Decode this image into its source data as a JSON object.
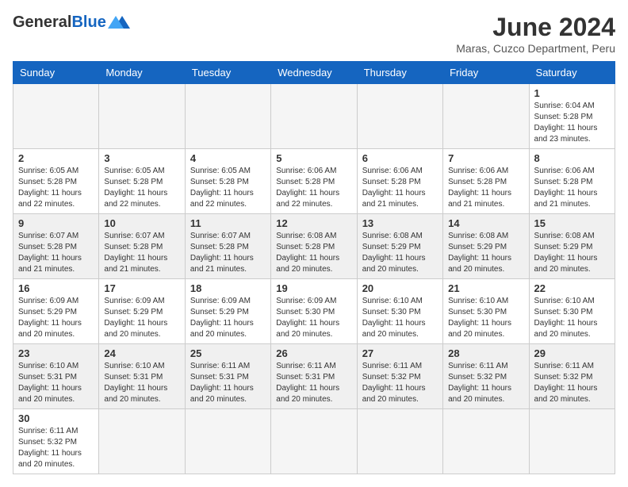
{
  "header": {
    "logo_general": "General",
    "logo_blue": "Blue",
    "month_title": "June 2024",
    "subtitle": "Maras, Cuzco Department, Peru"
  },
  "weekdays": [
    "Sunday",
    "Monday",
    "Tuesday",
    "Wednesday",
    "Thursday",
    "Friday",
    "Saturday"
  ],
  "weeks": [
    {
      "shaded": false,
      "days": [
        {
          "num": "",
          "info": ""
        },
        {
          "num": "",
          "info": ""
        },
        {
          "num": "",
          "info": ""
        },
        {
          "num": "",
          "info": ""
        },
        {
          "num": "",
          "info": ""
        },
        {
          "num": "",
          "info": ""
        },
        {
          "num": "1",
          "info": "Sunrise: 6:04 AM\nSunset: 5:28 PM\nDaylight: 11 hours\nand 23 minutes."
        }
      ]
    },
    {
      "shaded": false,
      "days": [
        {
          "num": "2",
          "info": "Sunrise: 6:05 AM\nSunset: 5:28 PM\nDaylight: 11 hours\nand 22 minutes."
        },
        {
          "num": "3",
          "info": "Sunrise: 6:05 AM\nSunset: 5:28 PM\nDaylight: 11 hours\nand 22 minutes."
        },
        {
          "num": "4",
          "info": "Sunrise: 6:05 AM\nSunset: 5:28 PM\nDaylight: 11 hours\nand 22 minutes."
        },
        {
          "num": "5",
          "info": "Sunrise: 6:06 AM\nSunset: 5:28 PM\nDaylight: 11 hours\nand 22 minutes."
        },
        {
          "num": "6",
          "info": "Sunrise: 6:06 AM\nSunset: 5:28 PM\nDaylight: 11 hours\nand 21 minutes."
        },
        {
          "num": "7",
          "info": "Sunrise: 6:06 AM\nSunset: 5:28 PM\nDaylight: 11 hours\nand 21 minutes."
        },
        {
          "num": "8",
          "info": "Sunrise: 6:06 AM\nSunset: 5:28 PM\nDaylight: 11 hours\nand 21 minutes."
        }
      ]
    },
    {
      "shaded": true,
      "days": [
        {
          "num": "9",
          "info": "Sunrise: 6:07 AM\nSunset: 5:28 PM\nDaylight: 11 hours\nand 21 minutes."
        },
        {
          "num": "10",
          "info": "Sunrise: 6:07 AM\nSunset: 5:28 PM\nDaylight: 11 hours\nand 21 minutes."
        },
        {
          "num": "11",
          "info": "Sunrise: 6:07 AM\nSunset: 5:28 PM\nDaylight: 11 hours\nand 21 minutes."
        },
        {
          "num": "12",
          "info": "Sunrise: 6:08 AM\nSunset: 5:28 PM\nDaylight: 11 hours\nand 20 minutes."
        },
        {
          "num": "13",
          "info": "Sunrise: 6:08 AM\nSunset: 5:29 PM\nDaylight: 11 hours\nand 20 minutes."
        },
        {
          "num": "14",
          "info": "Sunrise: 6:08 AM\nSunset: 5:29 PM\nDaylight: 11 hours\nand 20 minutes."
        },
        {
          "num": "15",
          "info": "Sunrise: 6:08 AM\nSunset: 5:29 PM\nDaylight: 11 hours\nand 20 minutes."
        }
      ]
    },
    {
      "shaded": false,
      "days": [
        {
          "num": "16",
          "info": "Sunrise: 6:09 AM\nSunset: 5:29 PM\nDaylight: 11 hours\nand 20 minutes."
        },
        {
          "num": "17",
          "info": "Sunrise: 6:09 AM\nSunset: 5:29 PM\nDaylight: 11 hours\nand 20 minutes."
        },
        {
          "num": "18",
          "info": "Sunrise: 6:09 AM\nSunset: 5:29 PM\nDaylight: 11 hours\nand 20 minutes."
        },
        {
          "num": "19",
          "info": "Sunrise: 6:09 AM\nSunset: 5:30 PM\nDaylight: 11 hours\nand 20 minutes."
        },
        {
          "num": "20",
          "info": "Sunrise: 6:10 AM\nSunset: 5:30 PM\nDaylight: 11 hours\nand 20 minutes."
        },
        {
          "num": "21",
          "info": "Sunrise: 6:10 AM\nSunset: 5:30 PM\nDaylight: 11 hours\nand 20 minutes."
        },
        {
          "num": "22",
          "info": "Sunrise: 6:10 AM\nSunset: 5:30 PM\nDaylight: 11 hours\nand 20 minutes."
        }
      ]
    },
    {
      "shaded": true,
      "days": [
        {
          "num": "23",
          "info": "Sunrise: 6:10 AM\nSunset: 5:31 PM\nDaylight: 11 hours\nand 20 minutes."
        },
        {
          "num": "24",
          "info": "Sunrise: 6:10 AM\nSunset: 5:31 PM\nDaylight: 11 hours\nand 20 minutes."
        },
        {
          "num": "25",
          "info": "Sunrise: 6:11 AM\nSunset: 5:31 PM\nDaylight: 11 hours\nand 20 minutes."
        },
        {
          "num": "26",
          "info": "Sunrise: 6:11 AM\nSunset: 5:31 PM\nDaylight: 11 hours\nand 20 minutes."
        },
        {
          "num": "27",
          "info": "Sunrise: 6:11 AM\nSunset: 5:32 PM\nDaylight: 11 hours\nand 20 minutes."
        },
        {
          "num": "28",
          "info": "Sunrise: 6:11 AM\nSunset: 5:32 PM\nDaylight: 11 hours\nand 20 minutes."
        },
        {
          "num": "29",
          "info": "Sunrise: 6:11 AM\nSunset: 5:32 PM\nDaylight: 11 hours\nand 20 minutes."
        }
      ]
    },
    {
      "shaded": false,
      "days": [
        {
          "num": "30",
          "info": "Sunrise: 6:11 AM\nSunset: 5:32 PM\nDaylight: 11 hours\nand 20 minutes."
        },
        {
          "num": "",
          "info": ""
        },
        {
          "num": "",
          "info": ""
        },
        {
          "num": "",
          "info": ""
        },
        {
          "num": "",
          "info": ""
        },
        {
          "num": "",
          "info": ""
        },
        {
          "num": "",
          "info": ""
        }
      ]
    }
  ]
}
